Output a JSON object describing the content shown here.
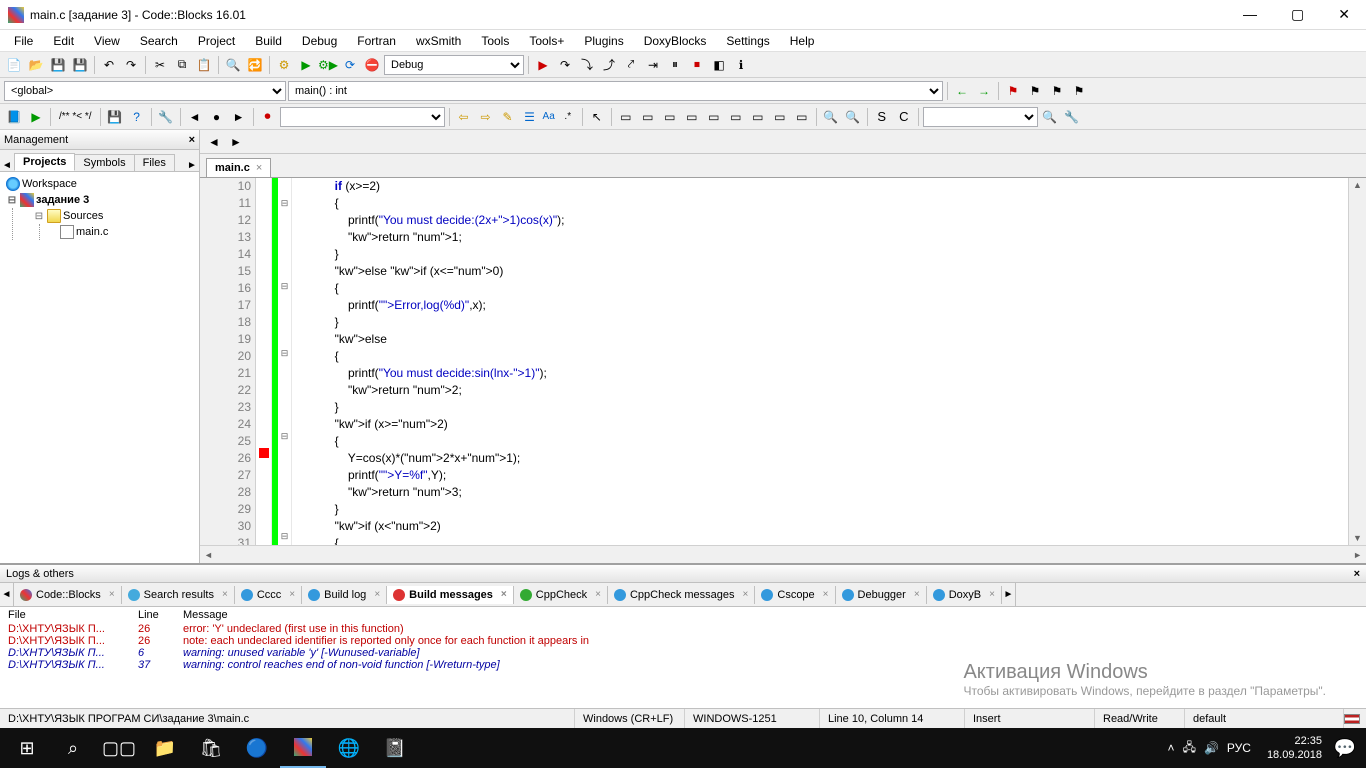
{
  "title": "main.c [задание 3] - Code::Blocks 16.01",
  "menu": [
    "File",
    "Edit",
    "View",
    "Search",
    "Project",
    "Build",
    "Debug",
    "Fortran",
    "wxSmith",
    "Tools",
    "Tools+",
    "Plugins",
    "DoxyBlocks",
    "Settings",
    "Help"
  ],
  "scope_combo": "<global>",
  "func_combo": "main() : int",
  "build_target": "Debug",
  "comment_style": "/**  *<  */",
  "management": {
    "title": "Management",
    "tabs": [
      "Projects",
      "Symbols",
      "Files"
    ],
    "active_tab": "Projects",
    "workspace": "Workspace",
    "project": "задание 3",
    "sources": "Sources",
    "file": "main.c"
  },
  "editor_tab": "main.c",
  "code": {
    "first_line": 10,
    "lines": [
      {
        "n": 10,
        "text": "        if (x>=2)"
      },
      {
        "n": 11,
        "text": "        {",
        "fold": "-"
      },
      {
        "n": 12,
        "text": "            printf(\"You must decide:(2x+1)cos(x)\");"
      },
      {
        "n": 13,
        "text": "            return 1;"
      },
      {
        "n": 14,
        "text": "        }"
      },
      {
        "n": 15,
        "text": "        else if (x<=0)"
      },
      {
        "n": 16,
        "text": "        {",
        "fold": "-"
      },
      {
        "n": 17,
        "text": "            printf(\"Error,log(%d)\",x);"
      },
      {
        "n": 18,
        "text": "        }"
      },
      {
        "n": 19,
        "text": "        else"
      },
      {
        "n": 20,
        "text": "        {",
        "fold": "-"
      },
      {
        "n": 21,
        "text": "            printf(\"You must decide:sin(lnx-1)\");"
      },
      {
        "n": 22,
        "text": "            return 2;"
      },
      {
        "n": 23,
        "text": "        }"
      },
      {
        "n": 24,
        "text": "        if (x>=2)"
      },
      {
        "n": 25,
        "text": "        {",
        "fold": "-"
      },
      {
        "n": 26,
        "text": "            Y=cos(x)*(2*x+1);",
        "marker": "error"
      },
      {
        "n": 27,
        "text": "            printf(\"Y=%f\",Y);"
      },
      {
        "n": 28,
        "text": "            return 3;"
      },
      {
        "n": 29,
        "text": "        }"
      },
      {
        "n": 30,
        "text": "        if (x<2)"
      },
      {
        "n": 31,
        "text": "        {",
        "fold": "-"
      }
    ]
  },
  "logs": {
    "title": "Logs & others",
    "tabs": [
      "Code::Blocks",
      "Search results",
      "Cccc",
      "Build log",
      "Build messages",
      "CppCheck",
      "CppCheck messages",
      "Cscope",
      "Debugger",
      "DoxyB"
    ],
    "active": "Build messages",
    "headers": {
      "file": "File",
      "line": "Line",
      "msg": "Message"
    },
    "rows": [
      {
        "file": "D:\\ХНТУ\\ЯЗЫК П...",
        "line": "26",
        "msg": "error: 'Y' undeclared (first use in this function)",
        "type": "err"
      },
      {
        "file": "D:\\ХНТУ\\ЯЗЫК П...",
        "line": "26",
        "msg": "note: each undeclared identifier is reported only once for each function it appears in",
        "type": "err"
      },
      {
        "file": "D:\\ХНТУ\\ЯЗЫК П...",
        "line": "6",
        "msg": "warning: unused variable 'y' [-Wunused-variable]",
        "type": "warn"
      },
      {
        "file": "D:\\ХНТУ\\ЯЗЫК П...",
        "line": "37",
        "msg": "warning: control reaches end of non-void function [-Wreturn-type]",
        "type": "warn"
      }
    ]
  },
  "watermark": {
    "title": "Активация Windows",
    "sub": "Чтобы активировать Windows, перейдите в раздел \"Параметры\"."
  },
  "status": {
    "path": "D:\\ХНТУ\\ЯЗЫК ПРОГРАМ СИ\\задание 3\\main.c",
    "eol": "Windows (CR+LF)",
    "encoding": "WINDOWS-1251",
    "pos": "Line 10, Column 14",
    "insert": "Insert",
    "rw": "Read/Write",
    "profile": "default"
  },
  "taskbar": {
    "time": "22:35",
    "date": "18.09.2018",
    "lang": "РУС"
  }
}
